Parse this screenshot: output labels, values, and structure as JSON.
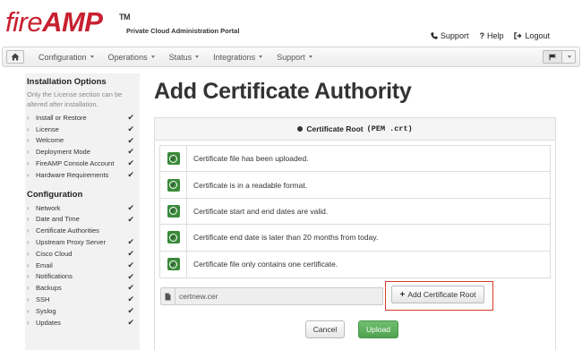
{
  "header": {
    "logo_fire": "fire",
    "logo_amp": "AMP",
    "logo_tm": "TM",
    "portal_title": "Private Cloud Administration Portal",
    "links": [
      {
        "label": "Support",
        "icon": "phone-icon"
      },
      {
        "label": "Help",
        "icon": "question-icon"
      },
      {
        "label": "Logout",
        "icon": "logout-icon"
      }
    ]
  },
  "navbar": {
    "items": [
      "Configuration",
      "Operations",
      "Status",
      "Integrations",
      "Support"
    ],
    "home_icon": "home-icon",
    "flag_icon": "flag-icon"
  },
  "sidebar": {
    "installation_heading": "Installation Options",
    "installation_note": "Only the License section can be altered after installation.",
    "installation_items": [
      {
        "label": "Install or Restore",
        "checked": true
      },
      {
        "label": "License",
        "checked": true
      },
      {
        "label": "Welcome",
        "checked": true
      },
      {
        "label": "Deployment Mode",
        "checked": true
      },
      {
        "label": "FireAMP Console Account",
        "checked": true
      },
      {
        "label": "Hardware Requirements",
        "checked": true
      }
    ],
    "configuration_heading": "Configuration",
    "configuration_items": [
      {
        "label": "Network",
        "checked": true
      },
      {
        "label": "Date and Time",
        "checked": true
      },
      {
        "label": "Certificate Authorities",
        "checked": false
      },
      {
        "label": "Upstream Proxy Server",
        "checked": true
      },
      {
        "label": "Cisco Cloud",
        "checked": true
      },
      {
        "label": "Email",
        "checked": true
      },
      {
        "label": "Notifications",
        "checked": true
      },
      {
        "label": "Backups",
        "checked": true
      },
      {
        "label": "SSH",
        "checked": true
      },
      {
        "label": "Syslog",
        "checked": true
      },
      {
        "label": "Updates",
        "checked": true
      }
    ]
  },
  "main": {
    "title": "Add Certificate Authority",
    "panel_title": "Certificate Root",
    "panel_title_mono": "(PEM .crt)",
    "checks": [
      "Certificate file has been uploaded.",
      "Certificate is in a readable format.",
      "Certificate start and end dates are valid.",
      "Certificate end date is later than 20 months from today.",
      "Certificate file only contains one certificate."
    ],
    "file_name": "certnew.cer",
    "add_root_label": "Add Certificate Root",
    "cancel_label": "Cancel",
    "upload_label": "Upload"
  },
  "colors": {
    "brand_red": "#c8202f",
    "success_green": "#3a8a3a",
    "upload_green": "#5cb25c",
    "highlight_red": "#d33c2c"
  }
}
